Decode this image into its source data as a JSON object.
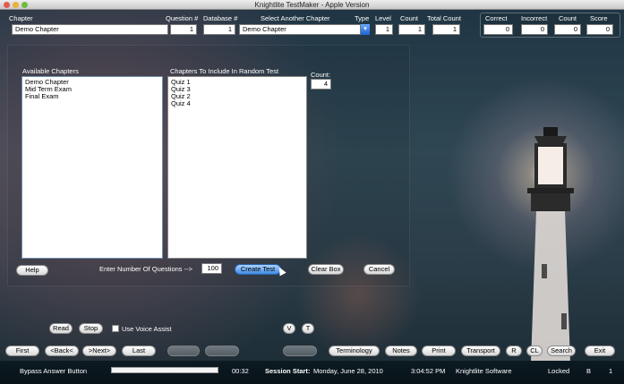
{
  "window": {
    "title": "Knightlite TestMaker - Apple Version"
  },
  "header": {
    "chapter_label": "Chapter",
    "chapter_value": "Demo Chapter",
    "question_label": "Question #",
    "question_value": "1",
    "database_label": "Database #",
    "database_value": "1",
    "select_chapter_label": "Select Another Chapter",
    "select_chapter_value": "Demo Chapter",
    "type_label": "Type",
    "level_label": "Level",
    "level_value": "1",
    "count_label": "Count",
    "count_value": "1",
    "total_count_label": "Total Count",
    "total_count_value": "1"
  },
  "scores": {
    "correct_label": "Correct",
    "correct_value": "0",
    "incorrect_label": "Incorrect",
    "incorrect_value": "0",
    "count_label": "Count",
    "count_value": "0",
    "score_label": "Score",
    "score_value": "0"
  },
  "random_test": {
    "available_label": "Available Chapters",
    "available": [
      "Demo Chapter",
      "Mid Term Exam",
      "Final Exam"
    ],
    "include_label": "Chapters To Include In Random Test",
    "include": [
      "Quiz 1",
      "Quiz 3",
      "Quiz 2",
      "Quiz 4"
    ],
    "count_label": "Count:",
    "count_value": "4",
    "enter_label": "Enter Number Of Questions -->",
    "questions_value": "100",
    "create_label": "Create Test",
    "clear_label": "Clear Box",
    "cancel_label": "Cancel",
    "help_label": "Help"
  },
  "voice": {
    "read_label": "Read",
    "stop_label": "Stop",
    "assist_label": "Use Voice Assist",
    "v_label": "V",
    "t_label": "T"
  },
  "nav": {
    "first": "First",
    "back": "<Back<",
    "next": ">Next>",
    "last": "Last",
    "terminology": "Terminology",
    "notes": "Notes",
    "print": "Print",
    "transport": "Transport",
    "r": "R",
    "cl": "CL",
    "search": "Search",
    "exit": "Exit"
  },
  "status": {
    "bypass": "Bypass Answer Button",
    "timer": "00:32",
    "session_label": "Session Start:",
    "session_date": "Monday, June 28, 2010",
    "session_time": "3:04:52 PM",
    "company": "Knightlite Software",
    "locked": "Locked",
    "b": "B",
    "one": "1"
  },
  "colors": {
    "accent_blue": "#3f8be3",
    "background": "#2f4753"
  },
  "icons": [
    "dropdown-arrow-icon",
    "mouse-pointer-icon"
  ]
}
